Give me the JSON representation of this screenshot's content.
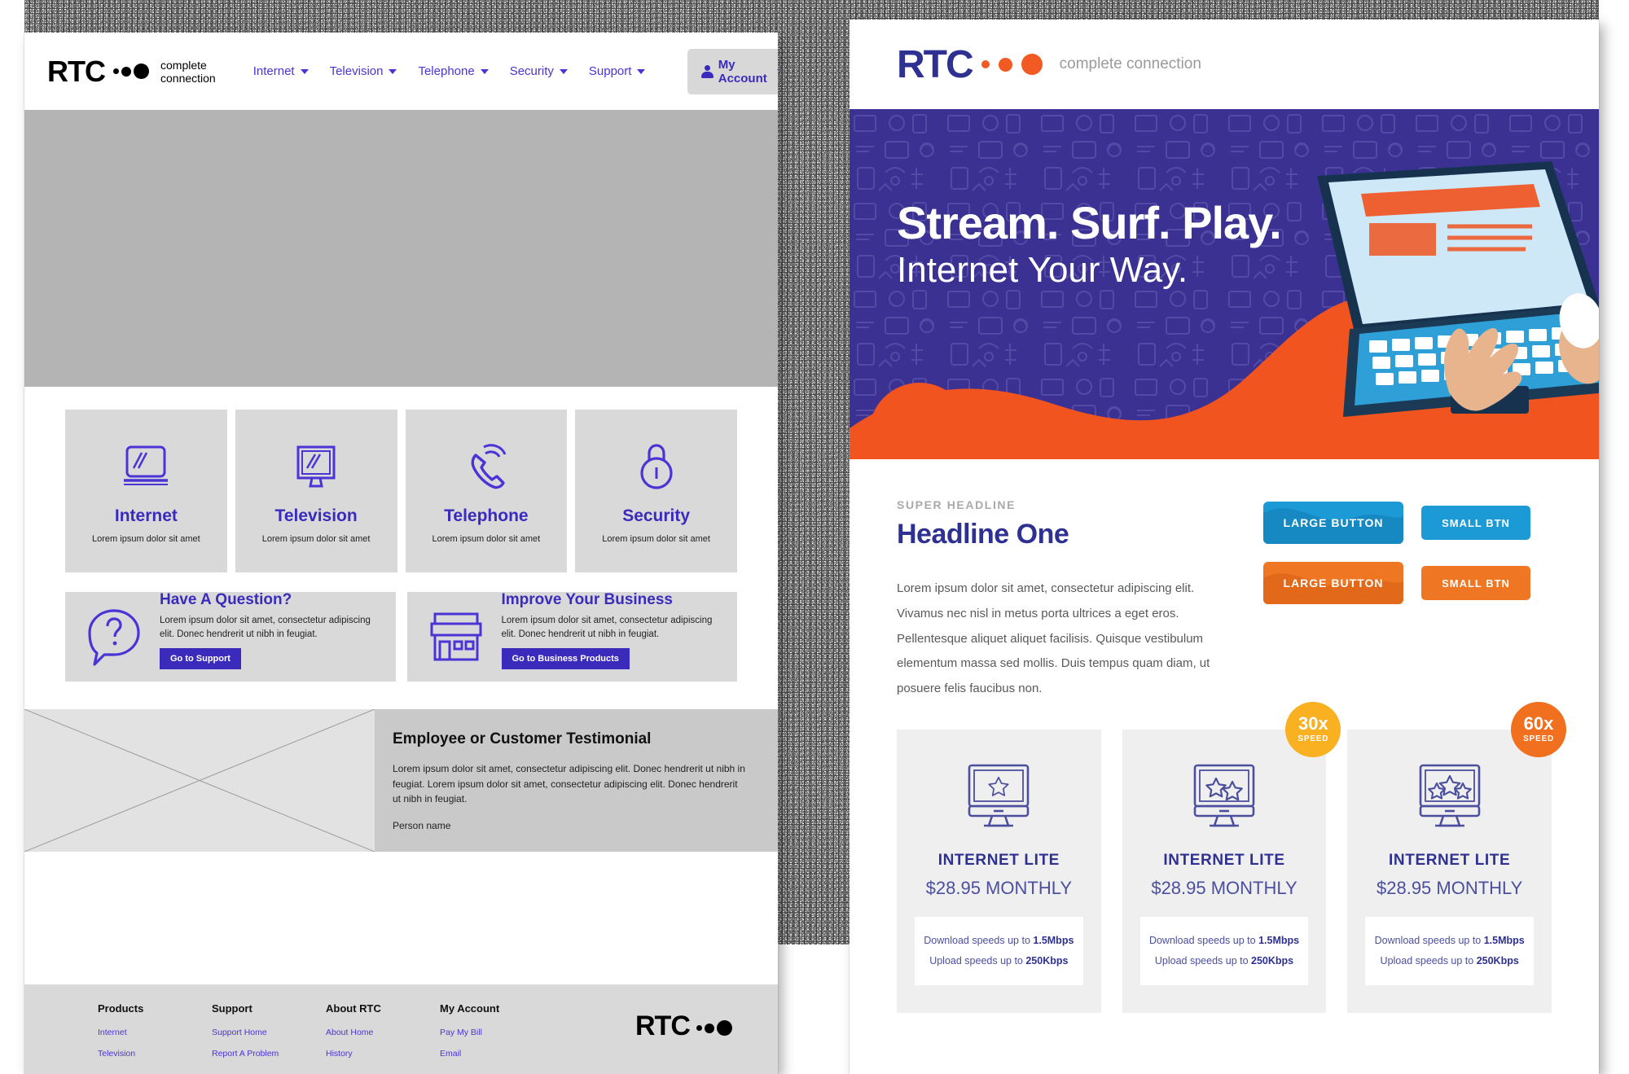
{
  "wireframe": {
    "logo": {
      "text": "RTC",
      "tagline": "complete connection"
    },
    "nav": [
      {
        "label": "Internet"
      },
      {
        "label": "Television"
      },
      {
        "label": "Telephone"
      },
      {
        "label": "Security"
      },
      {
        "label": "Support"
      }
    ],
    "account_button": {
      "label": "My Account"
    },
    "services": [
      {
        "title": "Internet",
        "subtitle": "Lorem ipsum dolor sit amet",
        "icon": "laptop-icon"
      },
      {
        "title": "Television",
        "subtitle": "Lorem ipsum dolor sit amet",
        "icon": "tv-icon"
      },
      {
        "title": "Telephone",
        "subtitle": "Lorem ipsum dolor sit amet",
        "icon": "phone-icon"
      },
      {
        "title": "Security",
        "subtitle": "Lorem ipsum dolor sit amet",
        "icon": "lock-icon"
      }
    ],
    "promos": [
      {
        "title": "Have A Question?",
        "text": "Lorem ipsum dolor sit amet, consectetur adipiscing elit. Donec hendrerit ut nibh in feugiat.",
        "button": "Go to Support",
        "icon": "question-bubble-icon"
      },
      {
        "title": "Improve Your Business",
        "text": "Lorem ipsum dolor sit amet, consectetur adipiscing elit. Donec hendrerit ut nibh in feugiat.",
        "button": "Go to Business Products",
        "icon": "storefront-icon"
      }
    ],
    "testimonial": {
      "title": "Employee or Customer Testimonial",
      "text": "Lorem ipsum dolor sit amet, consectetur adipiscing elit. Donec hendrerit ut nibh in feugiat. Lorem ipsum dolor sit amet, consectetur adipiscing elit. Donec hendrerit ut nibh in feugiat.",
      "person": "Person name"
    },
    "footer": {
      "columns": [
        {
          "title": "Products",
          "links": [
            "Internet",
            "Television"
          ]
        },
        {
          "title": "Support",
          "links": [
            "Support Home",
            "Report A Problem"
          ]
        },
        {
          "title": "About RTC",
          "links": [
            "About Home",
            "History"
          ]
        },
        {
          "title": "My Account",
          "links": [
            "Pay My Bill",
            "Email"
          ]
        }
      ],
      "logo": "RTC"
    }
  },
  "comp": {
    "logo": {
      "text": "RTC",
      "tagline": "complete connection"
    },
    "hero": {
      "line1": "Stream. Surf. Play.",
      "line2": "Internet Your Way."
    },
    "super_headline": "SUPER HEADLINE",
    "headline": "Headline One",
    "body": "Lorem ipsum dolor sit amet, consectetur adipiscing elit. Vivamus nec nisl in metus porta ultrices a eget eros. Pellentesque aliquet aliquet facilisis. Quisque vestibulum elementum massa sed mollis. Duis tempus quam diam, ut posuere felis faucibus non.",
    "buttons": {
      "large_blue": "LARGE BUTTON",
      "small_blue": "SMALL BTN",
      "large_orange": "LARGE BUTTON",
      "small_orange": "SMALL BTN"
    },
    "plans": [
      {
        "name": "INTERNET LITE",
        "price": "$28.95 MONTHLY",
        "download_prefix": "Download speeds up to ",
        "download_value": "1.5Mbps",
        "upload_prefix": "Upload speeds up to ",
        "upload_value": "250Kbps",
        "stars": 1,
        "badge": null
      },
      {
        "name": "INTERNET LITE",
        "price": "$28.95 MONTHLY",
        "download_prefix": "Download speeds up to ",
        "download_value": "1.5Mbps",
        "upload_prefix": "Upload speeds up to ",
        "upload_value": "250Kbps",
        "stars": 2,
        "badge": {
          "num": "30x",
          "word": "SPEED",
          "color": "#f9b021"
        }
      },
      {
        "name": "INTERNET LITE",
        "price": "$28.95 MONTHLY",
        "download_prefix": "Download speeds up to ",
        "download_value": "1.5Mbps",
        "upload_prefix": "Upload speeds up to ",
        "upload_value": "250Kbps",
        "stars": 3,
        "badge": {
          "num": "60x",
          "word": "SPEED",
          "color": "#f1701f"
        }
      }
    ]
  },
  "colors": {
    "wire_purple": "#3b2bbd",
    "brand_navy": "#2e3192",
    "brand_orange": "#f15a22",
    "hero_indigo": "#3b3192",
    "button_blue": "#1b9ad6",
    "button_orange": "#ef7622",
    "badge_yellow": "#f9b021",
    "badge_orange": "#f1701f"
  }
}
